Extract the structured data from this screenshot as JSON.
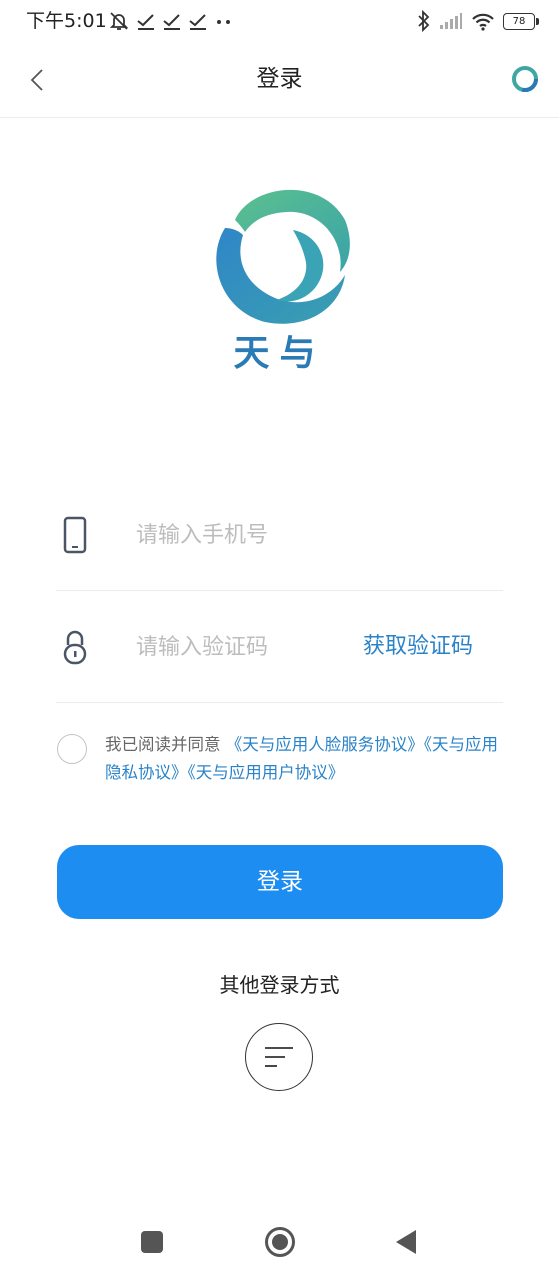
{
  "status": {
    "time": "下午5:01",
    "battery": "78"
  },
  "nav": {
    "title": "登录"
  },
  "app": {
    "name": "天与"
  },
  "form": {
    "phone_placeholder": "请输入手机号",
    "code_placeholder": "请输入验证码",
    "get_code_label": "获取验证码"
  },
  "agreement": {
    "prefix": "我已阅读并同意",
    "links": [
      "《天与应用人脸服务协议》",
      "《天与应用隐私协议》",
      "《天与应用用户协议》"
    ]
  },
  "login_button": "登录",
  "other_login": {
    "label": "其他登录方式"
  },
  "colors": {
    "accent": "#1e8df2",
    "link": "#2a83c9",
    "brand_teal": "#4fb89a",
    "brand_blue": "#2a7ab5"
  }
}
